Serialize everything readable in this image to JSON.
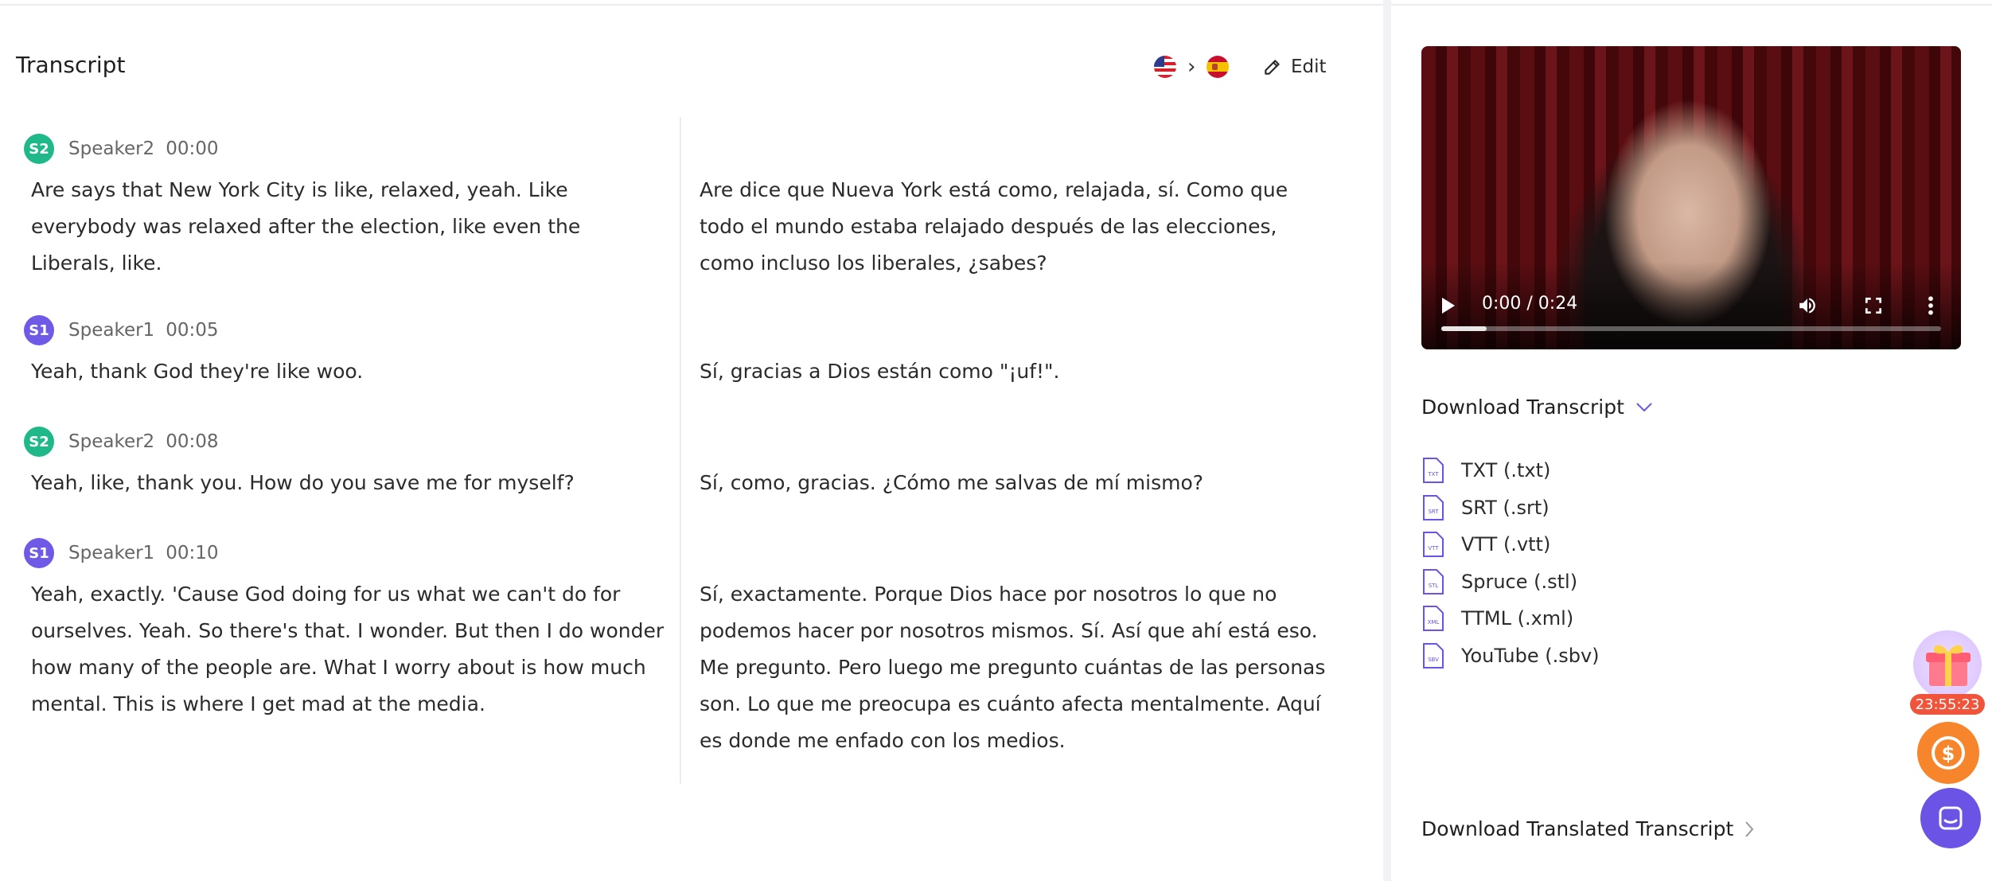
{
  "header": {
    "title": "Transcript",
    "source_lang_icon": "us-flag-icon",
    "target_lang_icon": "spain-flag-icon",
    "edit_label": "Edit"
  },
  "entries": [
    {
      "avatar": "S2",
      "speaker": "Speaker2",
      "time": "00:00",
      "original": "Are says that New York City is like, relaxed, yeah. Like everybody was relaxed after the election, like even the Liberals, like.",
      "translation": "Are dice que Nueva York está como, relajada, sí. Como que todo el mundo estaba relajado después de las elecciones, como incluso los liberales, ¿sabes?"
    },
    {
      "avatar": "S1",
      "speaker": "Speaker1",
      "time": "00:05",
      "original": "Yeah, thank God they're like woo.",
      "translation": "Sí, gracias a Dios están como \"¡uf!\"."
    },
    {
      "avatar": "S2",
      "speaker": "Speaker2",
      "time": "00:08",
      "original": "Yeah, like, thank you. How do you save me for myself?",
      "translation": "Sí, como, gracias. ¿Cómo me salvas de mí mismo?"
    },
    {
      "avatar": "S1",
      "speaker": "Speaker1",
      "time": "00:10",
      "original": "Yeah, exactly. 'Cause God doing for us what we can't do for ourselves. Yeah. So there's that. I wonder. But then I do wonder how many of the people are. What I worry about is how much mental. This is where I get mad at the media.",
      "translation": "Sí, exactamente. Porque Dios hace por nosotros lo que no podemos hacer por nosotros mismos. Sí. Así que ahí está eso. Me pregunto. Pero luego me pregunto cuántas de las personas son. Lo que me preocupa es cuánto afecta mentalmente. Aquí es donde me enfado con los medios."
    }
  ],
  "video": {
    "time_display": "0:00 / 0:24",
    "progress_fraction": 0.09
  },
  "download": {
    "heading": "Download Transcript",
    "formats": [
      {
        "tag": "TXT",
        "label": "TXT (.txt)"
      },
      {
        "tag": "SRT",
        "label": "SRT (.srt)"
      },
      {
        "tag": "VTT",
        "label": "VTT (.vtt)"
      },
      {
        "tag": "STL",
        "label": "Spruce (.stl)"
      },
      {
        "tag": "XML",
        "label": "TTML (.xml)"
      },
      {
        "tag": "SBV",
        "label": "YouTube (.sbv)"
      }
    ],
    "translated_heading": "Download Translated Transcript"
  },
  "widgets": {
    "promo_timer": "23:55:23"
  },
  "colors": {
    "speaker1": "#6e5ae6",
    "speaker2": "#1fb889",
    "accent_purple": "#6b53e6",
    "timer_red": "#f0543a",
    "coin_orange": "#f7852c"
  }
}
